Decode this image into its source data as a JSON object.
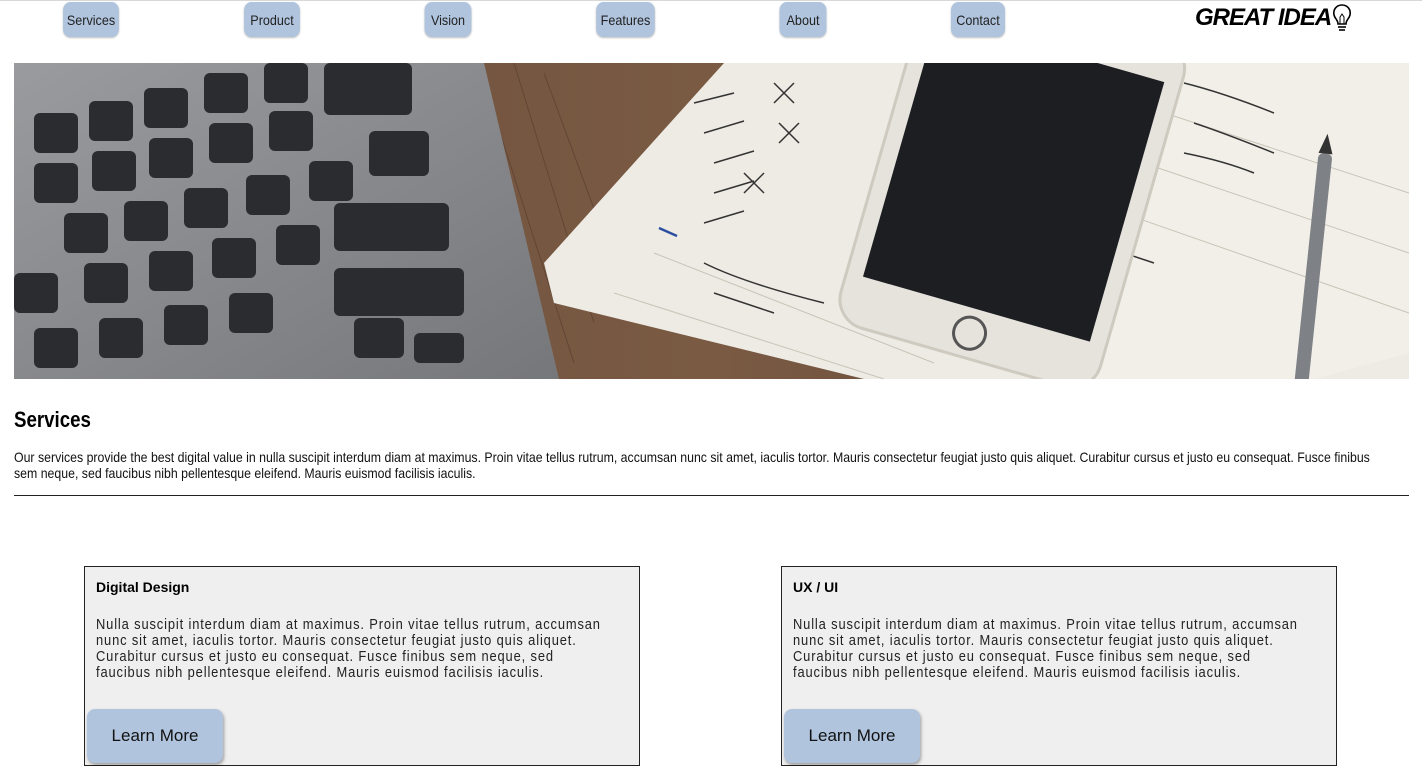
{
  "nav": {
    "items": [
      "Services",
      "Product",
      "Vision",
      "Features",
      "About",
      "Contact"
    ]
  },
  "logo": {
    "text": "GREAT IDEA",
    "icon": "lightbulb-icon"
  },
  "hero": {
    "image": "laptop-phone-notebook-photo"
  },
  "services": {
    "title": "Services",
    "intro": "Our services provide the best digital value in nulla suscipit interdum diam at maximus. Proin vitae tellus rutrum, accumsan nunc sit amet, iaculis tortor. Mauris consectetur feugiat justo quis aliquet. Curabitur cursus et justo eu consequat. Fusce finibus sem neque, sed faucibus nibh pellentesque eleifend. Mauris euismod facilisis iaculis."
  },
  "cards": [
    {
      "title": "Digital Design",
      "body": "Nulla suscipit interdum diam at maximus. Proin vitae tellus rutrum, accumsan nunc sit amet, iaculis tortor. Mauris consectetur feugiat justo quis aliquet. Curabitur cursus et justo eu consequat. Fusce finibus sem neque, sed faucibus nibh pellentesque eleifend. Mauris euismod facilisis iaculis.",
      "button": "Learn More"
    },
    {
      "title": "UX / UI",
      "body": "Nulla suscipit interdum diam at maximus. Proin vitae tellus rutrum, accumsan nunc sit amet, iaculis tortor. Mauris consectetur feugiat justo quis aliquet. Curabitur cursus et justo eu consequat. Fusce finibus sem neque, sed faucibus nibh pellentesque eleifend. Mauris euismod facilisis iaculis.",
      "button": "Learn More"
    }
  ],
  "colors": {
    "nav_button": "#b0c4de",
    "card_background": "#efefef"
  }
}
